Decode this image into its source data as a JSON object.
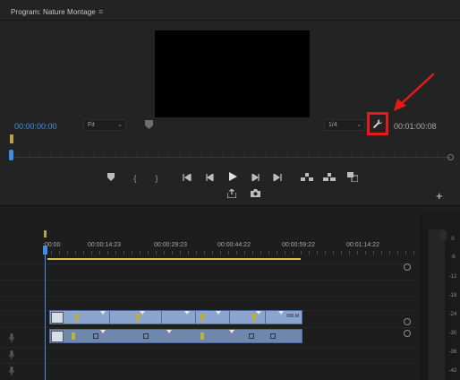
{
  "monitor": {
    "title": "Program: Nature Montage",
    "menu_icon": "≡",
    "timecode_in": "00:00:00:00",
    "fit_value": "Fit",
    "resolution_value": "1/4",
    "timecode_out": "00:01:00:08",
    "settings_icon": "wrench-icon"
  },
  "transport": {
    "marker": "marker-icon",
    "in": "{",
    "out": "}",
    "go_to_in": "go-to-in-icon",
    "step_back": "step-back-icon",
    "play": "play-icon",
    "step_forward": "step-forward-icon",
    "go_to_out": "go-to-out-icon",
    "lift": "lift-icon",
    "extract": "extract-icon",
    "compare": "compare-icon",
    "export_frame": "export-frame-icon",
    "camera": "camera-icon",
    "add_button": "+"
  },
  "timeline": {
    "ruler_labels": [
      ":00:00",
      "00:00:14:23",
      "00:00:29:23",
      "00:00:44:22",
      "00:00:59:22",
      "00:01:14:22"
    ],
    "video_clip_name": "006.M"
  },
  "meter": {
    "labels": [
      "0",
      "-6",
      "-12",
      "-18",
      "-24",
      "-30",
      "-36",
      "-42"
    ]
  },
  "colors": {
    "accent_blue": "#3f8ee8",
    "highlight_red": "#e51b1b",
    "clip_blue": "#8aa5cf",
    "workarea_yellow": "#d8c84a"
  }
}
